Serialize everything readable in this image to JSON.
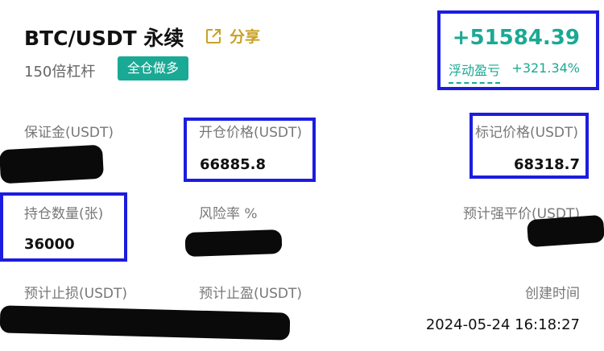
{
  "header": {
    "pair": "BTC/USDT 永续",
    "share_label": "分享",
    "leverage": "150倍杠杆",
    "mode_badge": "全仓做多",
    "pnl_value": "+51584.39",
    "pnl_label": "浮动盈亏",
    "pnl_percent": "+321.34%"
  },
  "fields": {
    "margin": {
      "label": "保证金(USDT)",
      "value": ""
    },
    "entry_price": {
      "label": "开仓价格(USDT)",
      "value": "66885.8"
    },
    "mark_price": {
      "label": "标记价格(USDT)",
      "value": "68318.7"
    },
    "position_size": {
      "label": "持仓数量(张)",
      "value": "36000"
    },
    "risk_rate": {
      "label": "风险率 %",
      "value": ""
    },
    "liq_price": {
      "label": "预计强平价(USDT)",
      "value": ""
    },
    "stop_loss": {
      "label": "预计止损(USDT)",
      "value": ""
    },
    "take_profit": {
      "label": "预计止盈(USDT)",
      "value": ""
    },
    "created_time": {
      "label": "创建时间",
      "value": "2024-05-24 16:18:27"
    }
  },
  "colors": {
    "accent_green": "#1aa994",
    "share_gold": "#c9a227",
    "highlight_blue": "#1c1ce0"
  },
  "icons": {
    "share": "share-icon"
  }
}
